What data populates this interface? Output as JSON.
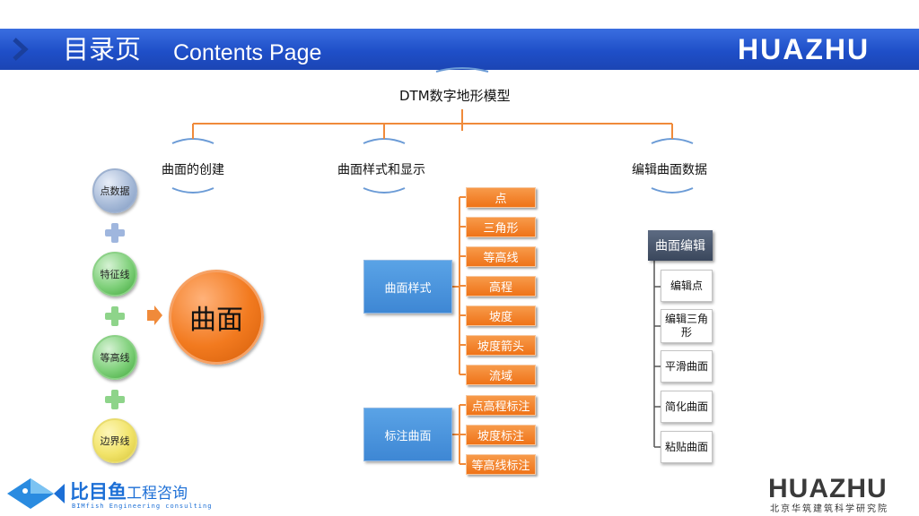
{
  "header": {
    "title_cn": "目录页",
    "title_en": "Contents Page",
    "logo_text": "HUAZHU"
  },
  "diagram": {
    "root": "DTM数字地形模型",
    "branches": [
      "曲面的创建",
      "曲面样式和显示",
      "编辑曲面数据"
    ],
    "creation": {
      "inputs": [
        "点数据",
        "特征线",
        "等高线",
        "边界线"
      ],
      "result": "曲面"
    },
    "style": {
      "style_box": "曲面样式",
      "style_items": [
        "点",
        "三角形",
        "等高线",
        "高程",
        "坡度",
        "坡度箭头",
        "流域"
      ],
      "label_box": "标注曲面",
      "label_items": [
        "点高程标注",
        "坡度标注",
        "等高线标注"
      ]
    },
    "edit": {
      "edit_box": "曲面编辑",
      "edit_items": [
        "编辑点",
        "编辑三角形",
        "平滑曲面",
        "简化曲面",
        "粘贴曲面"
      ]
    }
  },
  "footer": {
    "left_logo_main": "比目鱼",
    "left_logo_sub": "工程咨询",
    "left_logo_en": "BIMfish Engineering consulting",
    "right_logo": "HUAZHU",
    "right_logo_sub": "北京华筑建筑科学研究院"
  },
  "colors": {
    "header_blue": "#1f4fc8",
    "connector_orange": "#f08a3a",
    "box_orange": "#ef7318",
    "box_blue": "#3e87d4",
    "box_dark": "#3a475c"
  }
}
